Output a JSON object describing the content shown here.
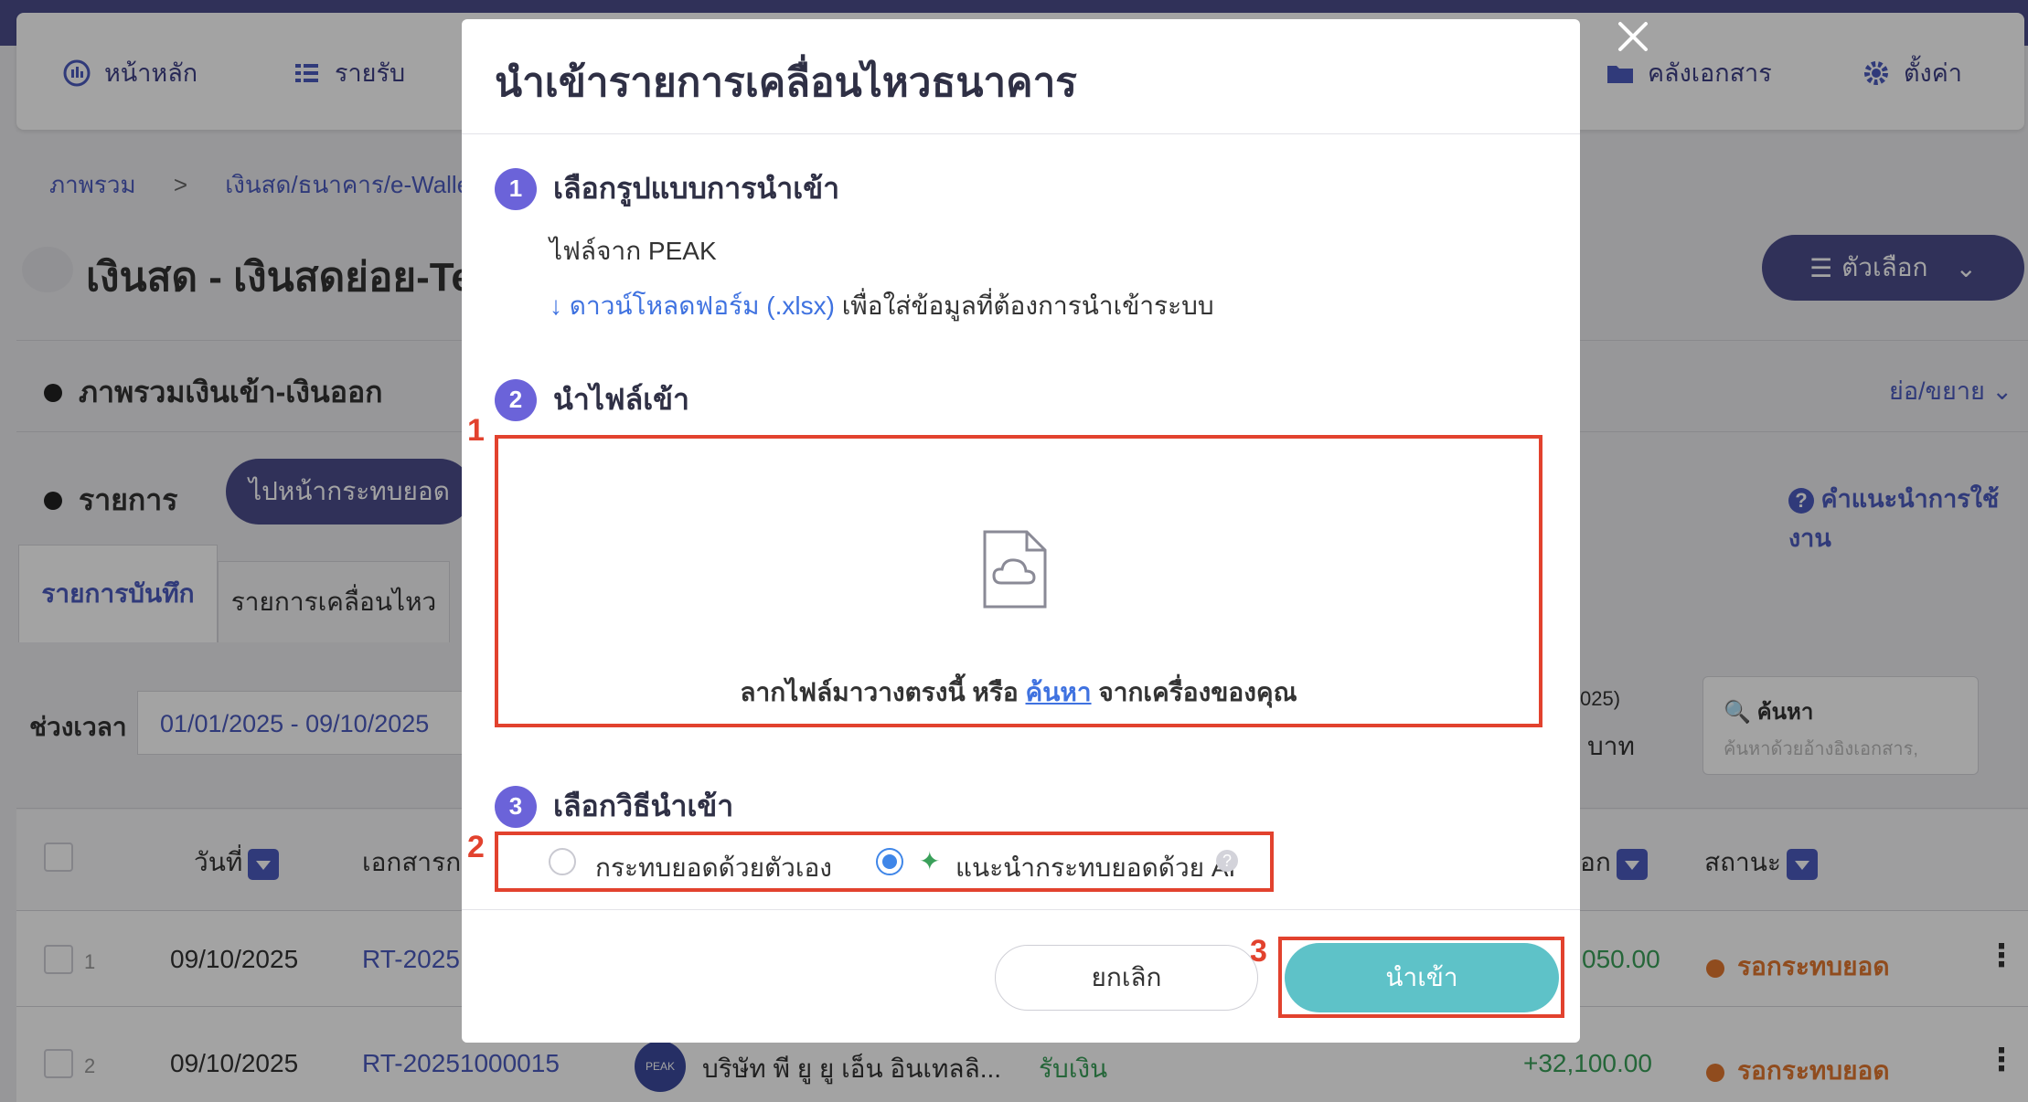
{
  "nav": {
    "home": "หน้าหลัก",
    "income": "รายรับ",
    "documents": "คลังเอกสาร",
    "settings": "ตั้งค่า"
  },
  "breadcrumb": {
    "root": "ภาพรวม",
    "sep": ">",
    "current": "เงินสด/ธนาคาร/e-Walle"
  },
  "page": {
    "title": "เงินสด - เงินสดย่อย-Te",
    "options_label": "ตัวเลือก",
    "overview_section": "ภาพรวมเงินเข้า-เงินออก",
    "collapse_label": "ย่อ/ขยาย",
    "items_section": "รายการ",
    "goto_reconcile": "ไปหน้ากระทบยอด",
    "help_label": "คำแนะนำการใช้งาน",
    "tabs": [
      "รายการบันทึก",
      "รายการเคลื่อนไหว"
    ],
    "period_label": "ช่วงเวลา",
    "period_value": "01/01/2025 - 09/10/2025",
    "summary_partial": "025)",
    "summary_unit": "บาท",
    "search_label": "ค้นหา",
    "search_placeholder": "ค้นหาด้วยอ้างอิงเอกสาร,"
  },
  "table": {
    "headers": {
      "date": "วันที่",
      "document": "เอกสารกร",
      "out": "อก",
      "status": "สถานะ"
    },
    "rows": [
      {
        "index": "1",
        "date": "09/10/2025",
        "doc": "RT-2025",
        "amount": "050.00",
        "status": "รอกระทบยอด"
      },
      {
        "index": "2",
        "date": "09/10/2025",
        "doc": "RT-20251000015",
        "logo": "PEAK",
        "contact": "บริษัท พี ยู ยู เอ็น อินเทลลิ...",
        "type": "รับเงิน",
        "amount": "+32,100.00",
        "status": "รอกระทบยอด"
      }
    ]
  },
  "modal": {
    "title": "นำเข้ารายการเคลื่อนไหวธนาคาร",
    "step1": {
      "number": "1",
      "title": "เลือกรูปแบบการนำเข้า",
      "source": "ไฟล์จาก PEAK",
      "download_link": "ดาวน์โหลดฟอร์ม (.xlsx)",
      "download_suffix": "เพื่อใส่ข้อมูลที่ต้องการนำเข้าระบบ"
    },
    "step2": {
      "number": "2",
      "title": "นำไฟล์เข้า",
      "drop_prefix": "ลากไฟล์มาวางตรงนี้ หรือ",
      "drop_link": "ค้นหา",
      "drop_suffix": "จากเครื่องของคุณ"
    },
    "step3": {
      "number": "3",
      "title": "เลือกวิธีนำเข้า",
      "option_manual": "กระทบยอดด้วยตัวเอง",
      "option_ai": "แนะนำกระทบยอดด้วย AI",
      "selected": "option_ai"
    },
    "cancel_label": "ยกเลิก",
    "import_label": "นำเข้า"
  },
  "annotations": [
    "1",
    "2",
    "3"
  ],
  "colors": {
    "accent": "#4b4d8c",
    "step_badge": "#6b63d9",
    "link": "#3f72e0",
    "import_button": "#5ec2c8",
    "annotation_red": "#e2422e",
    "pending_orange": "#e27830"
  }
}
